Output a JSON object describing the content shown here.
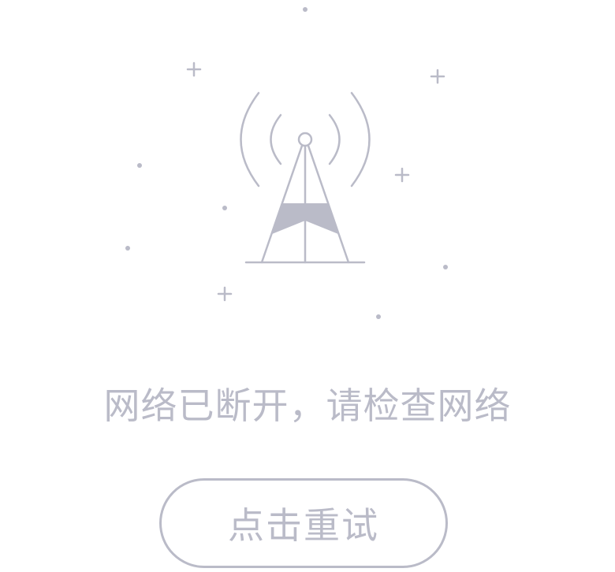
{
  "empty_state": {
    "icon": "network-disconnected-tower-icon",
    "message": "网络已断开，请检查网络",
    "retry_button_label": "点击重试"
  },
  "colors": {
    "icon_and_text": "#babbc8",
    "background": "#ffffff"
  }
}
